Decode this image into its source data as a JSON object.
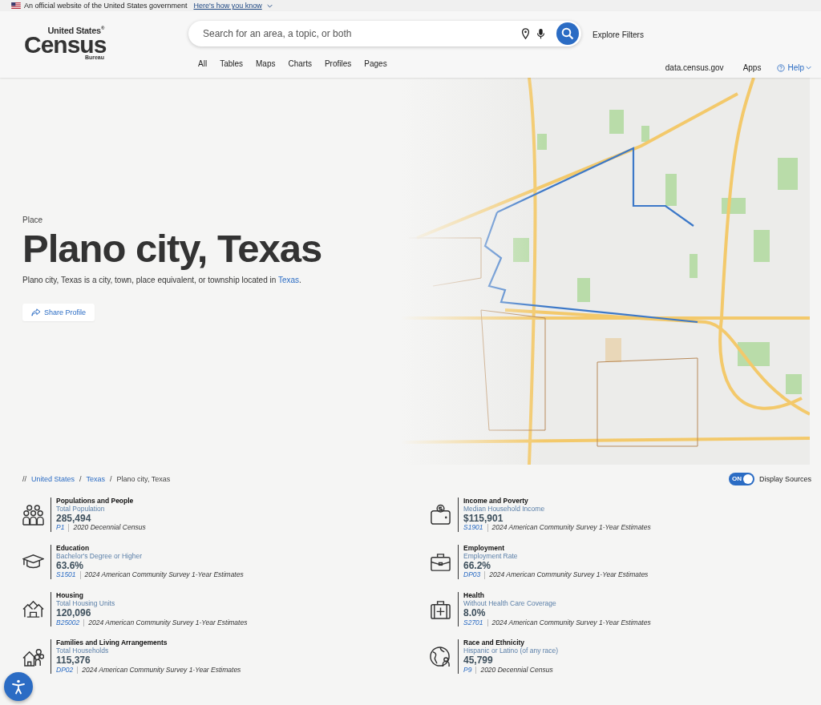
{
  "gov_banner": {
    "text": "An official website of the United States government",
    "link": "Here's how you know"
  },
  "logo": {
    "line_1": "United States",
    "registered": "®",
    "line_2": "Census",
    "line_3": "Bureau"
  },
  "search": {
    "placeholder": "Search for an area, a topic, or both"
  },
  "explore_filters": "Explore Filters",
  "nav_tabs": [
    {
      "label": "All",
      "selected": false
    },
    {
      "label": "Tables",
      "selected": false
    },
    {
      "label": "Maps",
      "selected": false
    },
    {
      "label": "Charts",
      "selected": false
    },
    {
      "label": "Profiles",
      "selected": false
    },
    {
      "label": "Pages",
      "selected": false
    }
  ],
  "utility_links": [
    "data.census.gov",
    "Apps",
    "Help"
  ],
  "hero": {
    "eyebrow": "Place",
    "title": "Plano city, Texas",
    "description": "Plano city, Texas is a city, town, place equivalent, or township located in ",
    "description_link": "Texas",
    "description_end": ".",
    "share_button": "Share Profile"
  },
  "breadcrumb": {
    "separator_start": "//",
    "items": [
      {
        "label": "United States",
        "link": true
      },
      {
        "label": "Texas",
        "link": true
      },
      {
        "label": "Plano city, Texas",
        "link": false
      }
    ],
    "separator": "/"
  },
  "display_sources": {
    "label": "Display Sources",
    "on": true,
    "switch_text": "ON"
  },
  "stats": [
    {
      "kind": "people",
      "topic": "Populations and People",
      "measure": "Total Population",
      "value": "285,494",
      "table": "P1",
      "source": "2020 Decennial Census"
    },
    {
      "kind": "income",
      "topic": "Income and Poverty",
      "measure": "Median Household Income",
      "value": "$115,901",
      "table": "S1901",
      "source": "2024 American Community Survey 1-Year Estimates"
    },
    {
      "kind": "education",
      "topic": "Education",
      "measure": "Bachelor's Degree or Higher",
      "value": "63.6%",
      "table": "S1501",
      "source": "2024 American Community Survey 1-Year Estimates"
    },
    {
      "kind": "employment",
      "topic": "Employment",
      "measure": "Employment Rate",
      "value": "66.2%",
      "table": "DP03",
      "source": "2024 American Community Survey 1-Year Estimates"
    },
    {
      "kind": "housing",
      "topic": "Housing",
      "measure": "Total Housing Units",
      "value": "120,096",
      "table": "B25002",
      "source": "2024 American Community Survey 1-Year Estimates"
    },
    {
      "kind": "health",
      "topic": "Health",
      "measure": "Without Health Care Coverage",
      "value": "8.0%",
      "table": "S2701",
      "source": "2024 American Community Survey 1-Year Estimates"
    },
    {
      "kind": "families",
      "topic": "Families and Living Arrangements",
      "measure": "Total Households",
      "value": "115,376",
      "table": "DP02",
      "source": "2024 American Community Survey 1-Year Estimates"
    },
    {
      "kind": "race",
      "topic": "Race and Ethnicity",
      "measure": "Hispanic or Latino (of any race)",
      "value": "45,799",
      "table": "P9",
      "source": "2020 Decennial Census"
    }
  ]
}
